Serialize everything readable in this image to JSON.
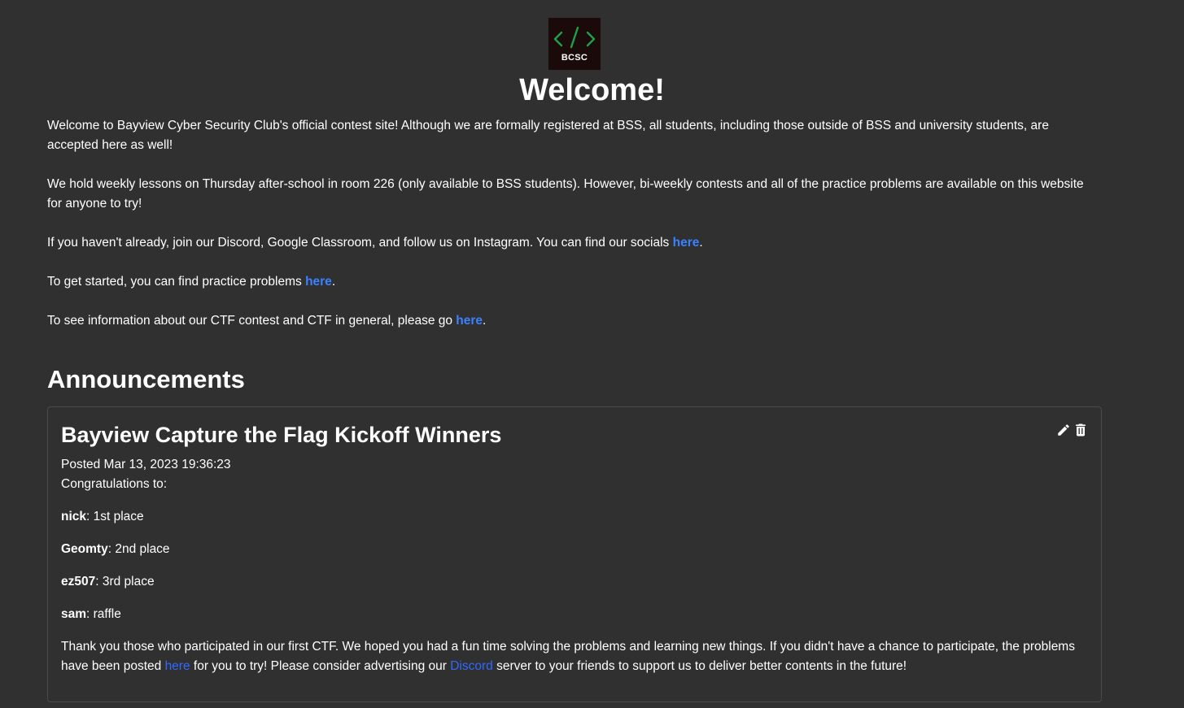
{
  "logo": {
    "text": "BCSC",
    "accent_color": "#22a047",
    "icon": "code-brackets-icon"
  },
  "title": "Welcome!",
  "intro": {
    "p1": "Welcome to Bayview Cyber Security Club's official contest site! Although we are formally registered at BSS, all students, including those outside of BSS and university students, are accepted here as well!",
    "p2": "We hold weekly lessons on Thursday after-school in room 226 (only available to BSS students). However, bi-weekly contests and all of the practice problems are available on this website for anyone to try!",
    "p3_before": "If you haven't already, join our Discord, Google Classroom, and follow us on Instagram. You can find our socials ",
    "p3_link": "here",
    "p3_after": ".",
    "p4_before": "To get started, you can find practice problems ",
    "p4_link": "here",
    "p4_after": ".",
    "p5_before": "To see information about our CTF contest and CTF in general, please go ",
    "p5_link": "here",
    "p5_after": "."
  },
  "announcements": {
    "heading": "Announcements",
    "items": [
      {
        "title": "Bayview Capture the Flag Kickoff Winners",
        "posted": "Posted Mar 13, 2023 19:36:23",
        "intro": "Congratulations to:",
        "winners": [
          {
            "name": "nick",
            "place": ": 1st place"
          },
          {
            "name": "Geomty",
            "place": ": 2nd place"
          },
          {
            "name": "ez507",
            "place": ": 3rd place"
          },
          {
            "name": "sam",
            "place": ": raffle"
          }
        ],
        "closing_1": "Thank you those who participated in our first CTF. We hoped you had a fun time solving the problems and learning new things. If you didn't have a chance to participate, the problems have been posted ",
        "closing_link_1": "here",
        "closing_2": " for you to try! Please consider advertising our ",
        "closing_link_2": "Discord",
        "closing_3": " server to your friends to support us to deliver better contents in the future!",
        "actions": {
          "edit_icon": "pencil-icon",
          "delete_icon": "trash-icon"
        }
      }
    ]
  },
  "colors": {
    "background": "#303030",
    "text": "#ffffff",
    "link": "#3b82ff",
    "card_border": "#4a4a4a"
  }
}
